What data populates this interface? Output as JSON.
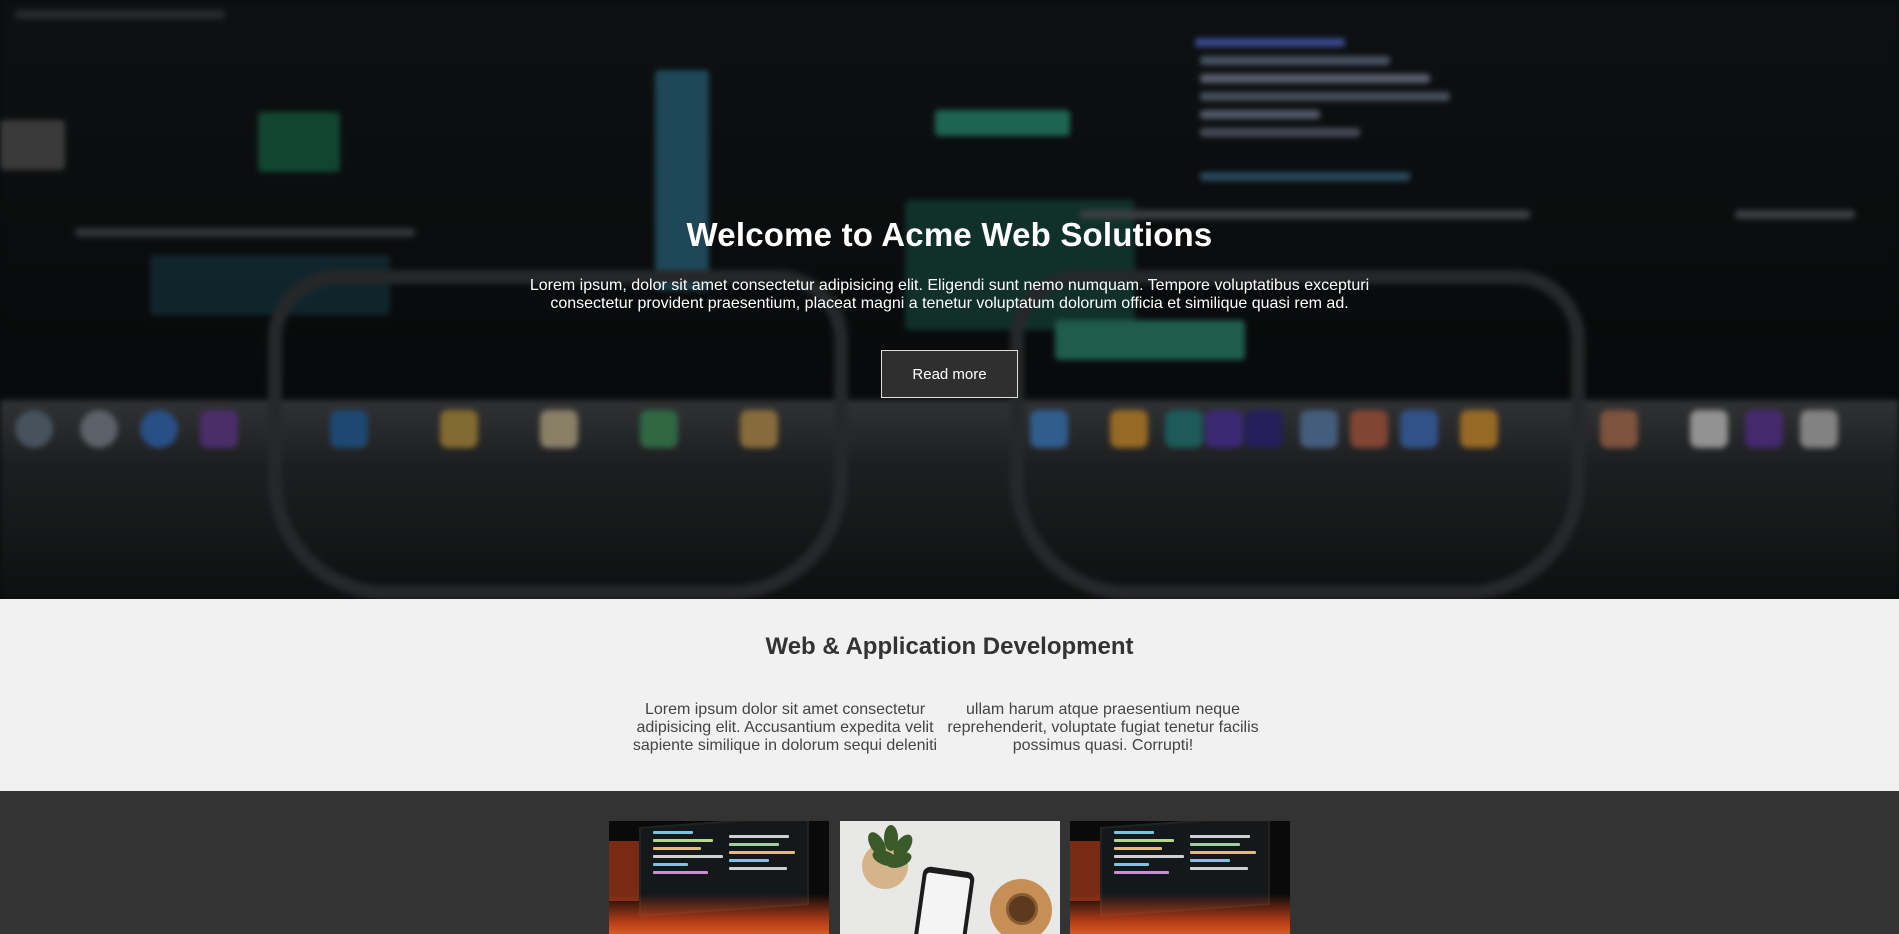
{
  "hero": {
    "title": "Welcome to Acme Web Solutions",
    "text": "Lorem ipsum, dolor sit amet consectetur adipisicing elit. Eligendi sunt nemo numquam. Tempore voluptatibus excepturi consectetur provident praesentium, placeat magni a tenetur voluptatum dolorum officia et similique quasi rem ad.",
    "button_label": "Read more"
  },
  "services": {
    "title": "Web & Application Development",
    "col1": "Lorem ipsum dolor sit amet consectetur adipisicing elit. Accusantium expedita velit sapiente similique in dolorum sequi deleniti",
    "col2": "ullam harum atque praesentium neque reprehenderit, voluptate fugiat tenetur facilis possimus quasi. Corrupti!"
  },
  "gallery": {
    "items": [
      "code-laptop-photo",
      "desk-phone-plant-photo",
      "code-laptop-photo"
    ]
  },
  "colors": {
    "hero_bg": "#0e1113",
    "services_bg": "#f1f1f1",
    "gallery_bg": "#333333",
    "button_bg": "#2f2f2f"
  }
}
